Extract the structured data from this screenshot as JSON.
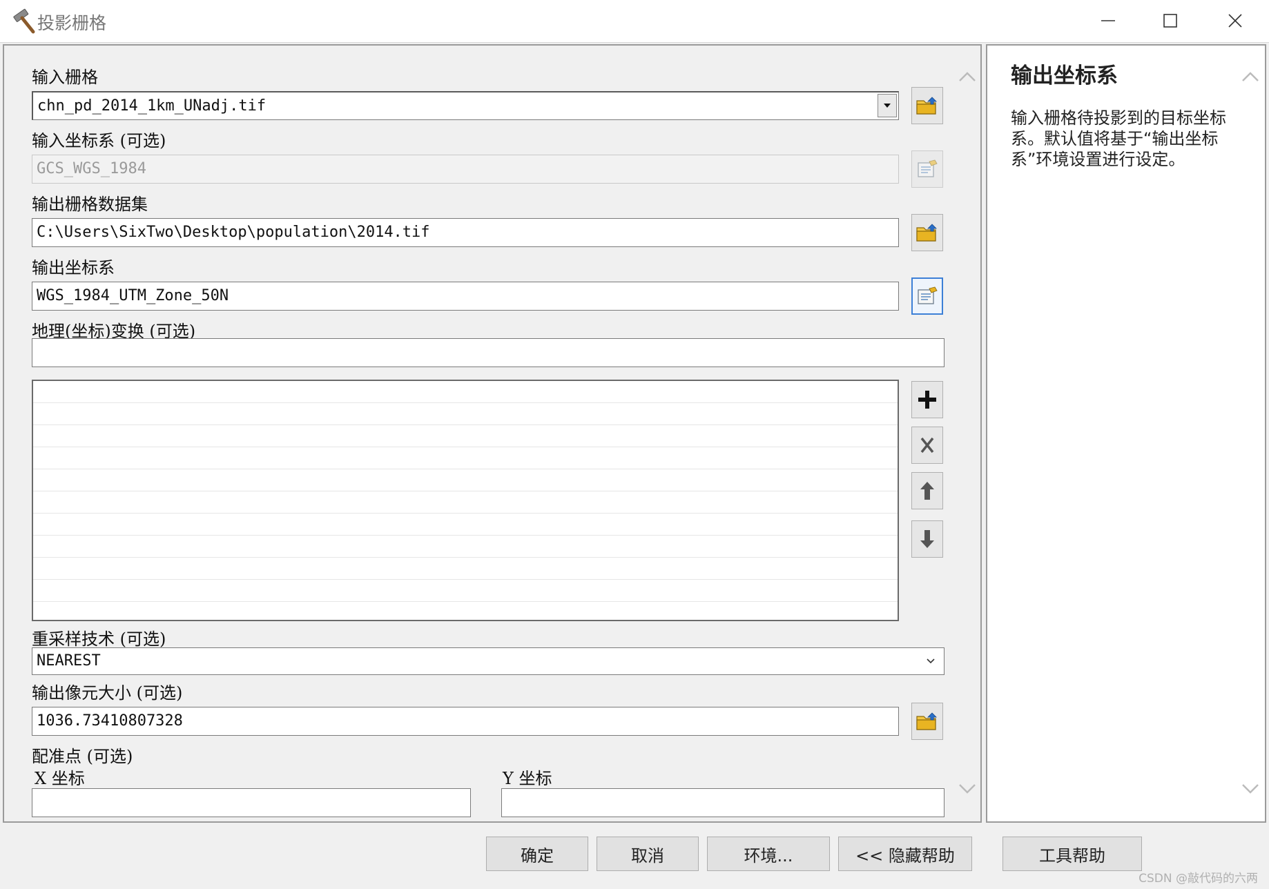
{
  "window": {
    "title": "投影栅格",
    "icon": "hammer-icon",
    "controls": [
      "minimize-icon",
      "maximize-icon",
      "close-icon"
    ]
  },
  "form": {
    "input_raster": {
      "label": "输入栅格",
      "value": "chn_pd_2014_1km_UNadj.tif"
    },
    "input_crs": {
      "label": "输入坐标系 (可选)",
      "value": "GCS_WGS_1984"
    },
    "output_raster": {
      "label": "输出栅格数据集",
      "value": "C:\\Users\\SixTwo\\Desktop\\population\\2014.tif"
    },
    "output_crs": {
      "label": "输出坐标系",
      "value": "WGS_1984_UTM_Zone_50N"
    },
    "geo_transform": {
      "label": "地理(坐标)变换 (可选)",
      "value": ""
    },
    "resampling": {
      "label": "重采样技术 (可选)",
      "value": "NEAREST"
    },
    "cell_size": {
      "label": "输出像元大小 (可选)",
      "value": "1036.73410807328"
    },
    "registration": {
      "label": "配准点 (可选)",
      "x_label": "X 坐标",
      "y_label": "Y 坐标",
      "x_value": "",
      "y_value": ""
    }
  },
  "help": {
    "title": "输出坐标系",
    "body": "输入栅格待投影到的目标坐标系。默认值将基于“输出坐标系”环境设置进行设定。"
  },
  "buttons": {
    "ok": "确定",
    "cancel": "取消",
    "env": "环境...",
    "hide_help": "<< 隐藏帮助",
    "tool_help": "工具帮助"
  },
  "watermark": "CSDN @敲代码的六两",
  "colors": {
    "accent_border": "#3c7fd6",
    "folder_yellow": "#e8b422",
    "folder_arrow_blue": "#2a6fc9"
  }
}
